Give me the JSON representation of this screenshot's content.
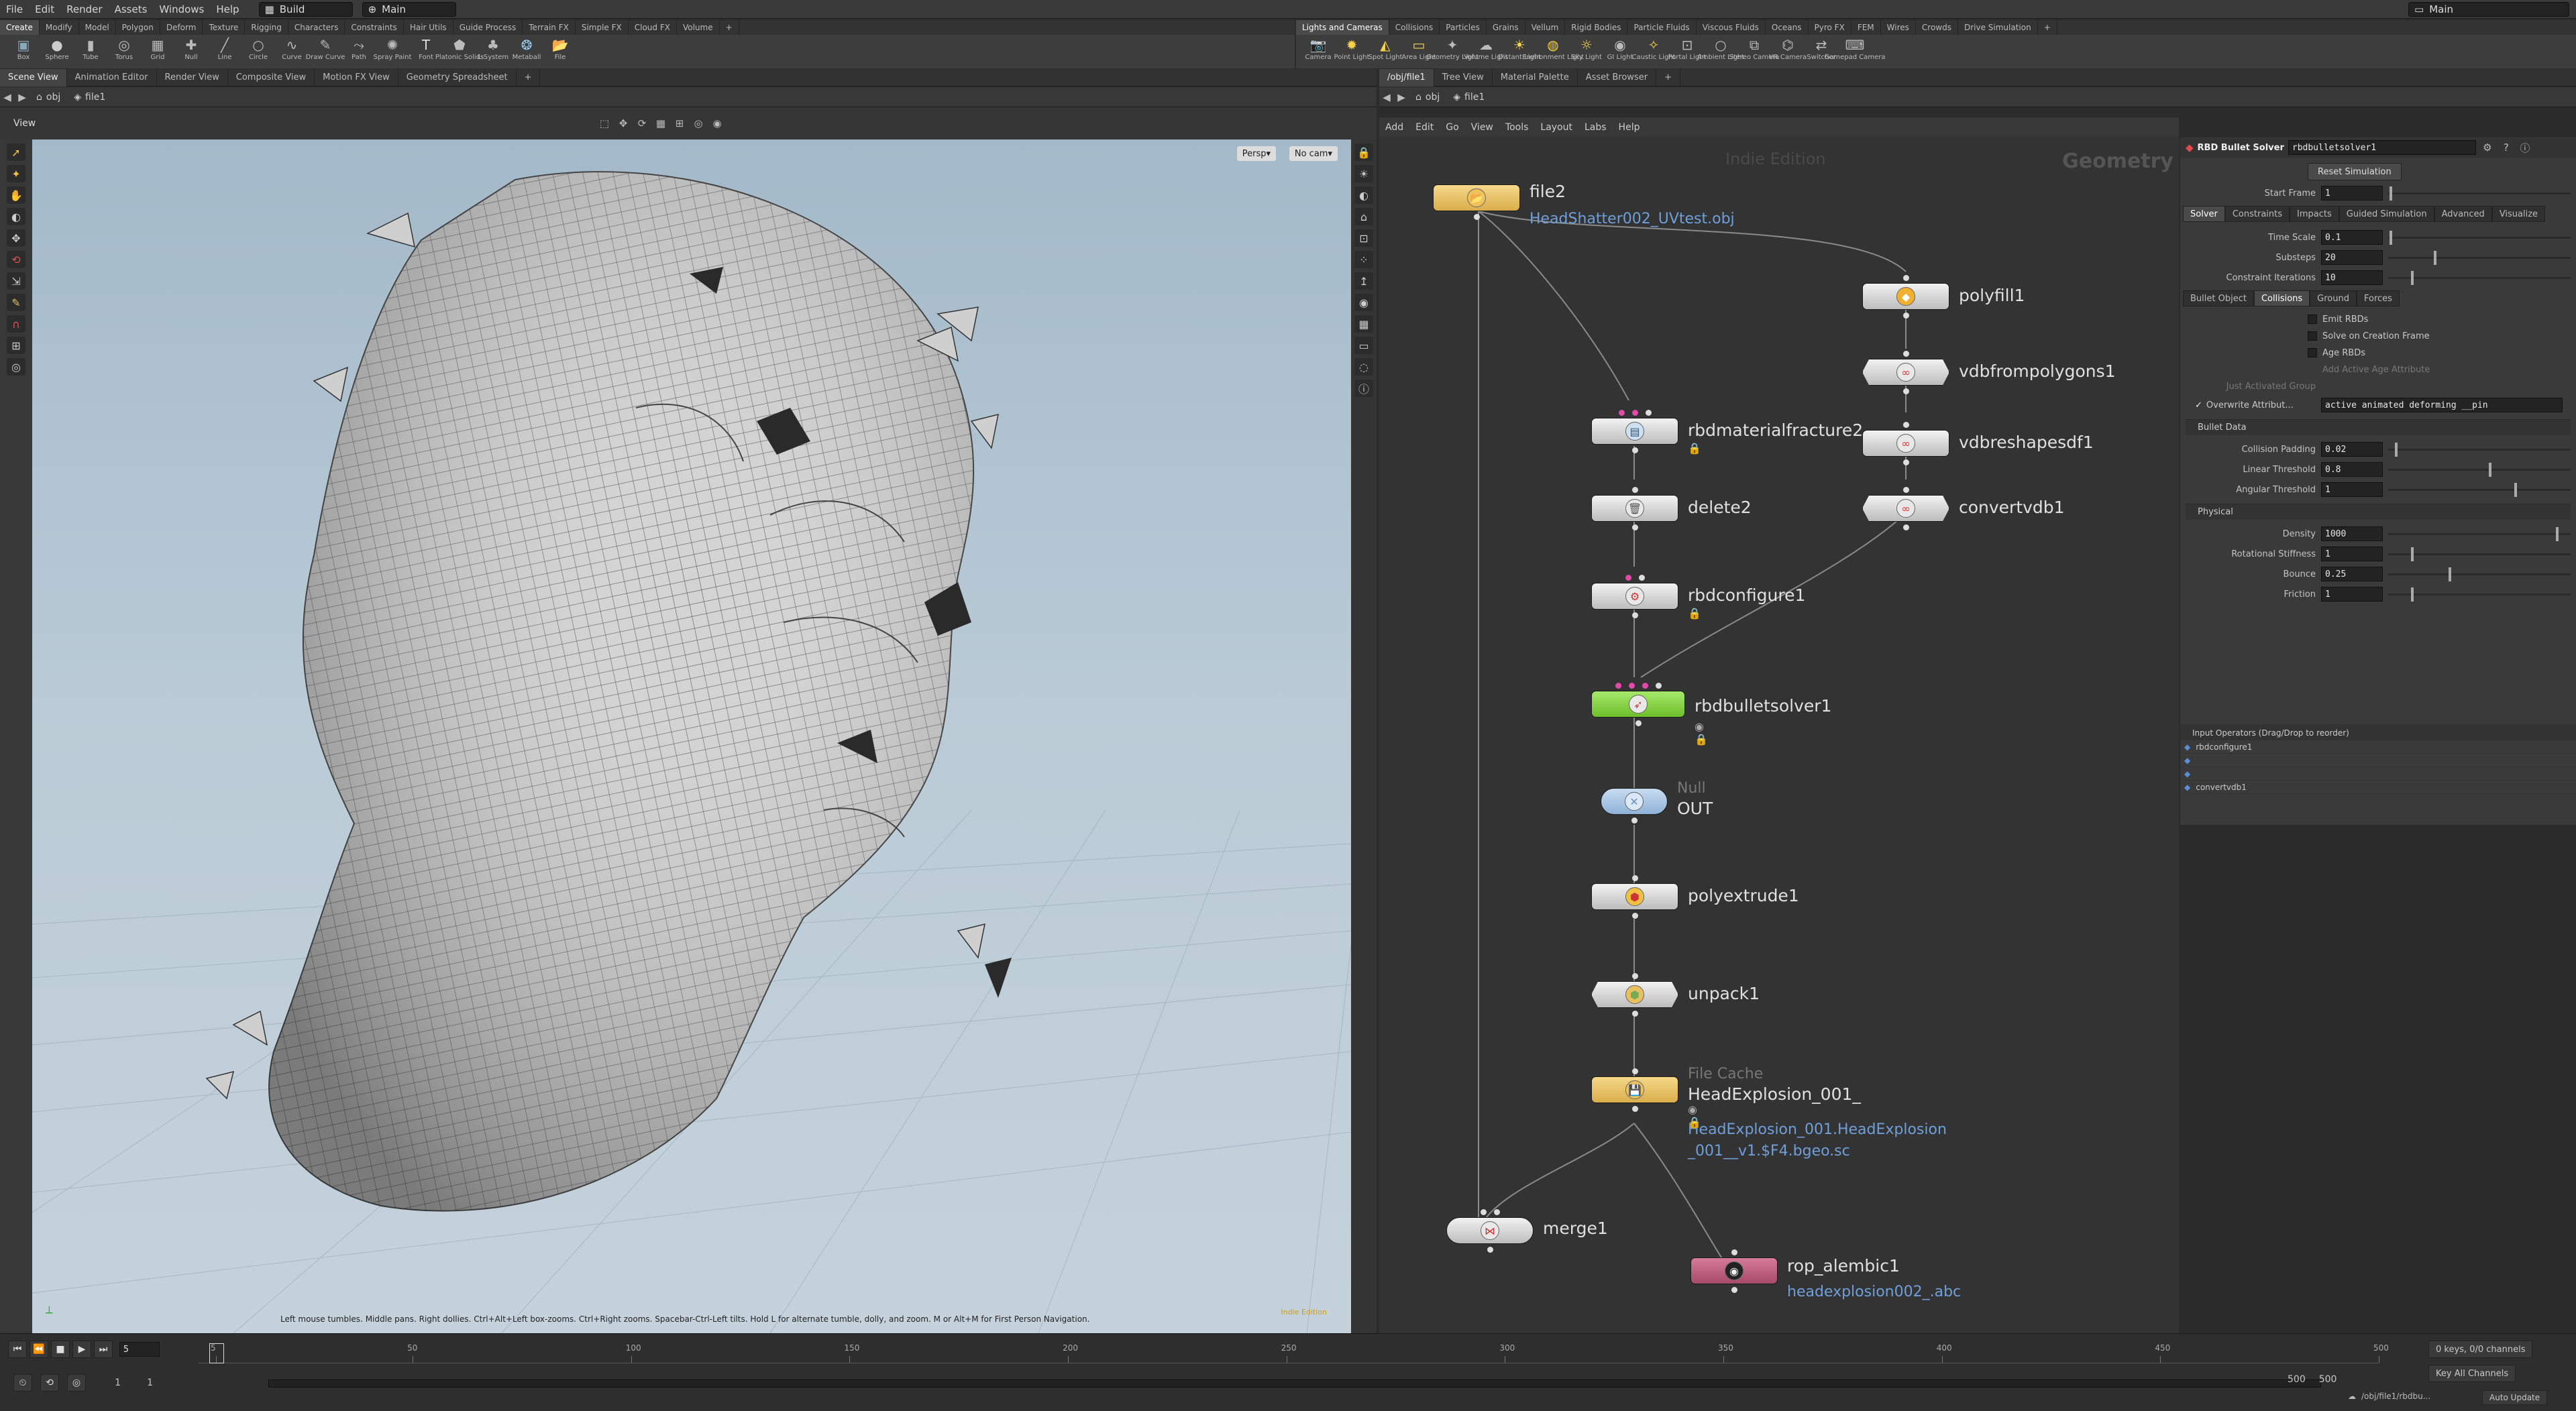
{
  "menubar": {
    "items": [
      "File",
      "Edit",
      "Render",
      "Assets",
      "Windows",
      "Help"
    ],
    "desktop": "Build",
    "context": "Main",
    "context_right": "Main"
  },
  "shelf_left": {
    "tabs": [
      "Create",
      "Modify",
      "Model",
      "Polygon",
      "Deform",
      "Texture",
      "Rigging",
      "Characters",
      "Constraints",
      "Hair Utils",
      "Guide Process",
      "Terrain FX",
      "Simple FX",
      "Cloud FX",
      "Volume"
    ],
    "tools": [
      {
        "label": "Box",
        "icon": "box-icon"
      },
      {
        "label": "Sphere",
        "icon": "sphere-icon"
      },
      {
        "label": "Tube",
        "icon": "tube-icon"
      },
      {
        "label": "Torus",
        "icon": "torus-icon"
      },
      {
        "label": "Grid",
        "icon": "grid-icon"
      },
      {
        "label": "Null",
        "icon": "null-icon"
      },
      {
        "label": "Line",
        "icon": "line-icon"
      },
      {
        "label": "Circle",
        "icon": "circle-icon"
      },
      {
        "label": "Curve",
        "icon": "curve-icon"
      },
      {
        "label": "Draw Curve",
        "icon": "draw-curve-icon"
      },
      {
        "label": "Path",
        "icon": "path-icon"
      },
      {
        "label": "Spray Paint",
        "icon": "spray-paint-icon"
      },
      {
        "label": "Font",
        "icon": "font-icon"
      },
      {
        "label": "Platonic Solids",
        "icon": "platonic-icon"
      },
      {
        "label": "L-System",
        "icon": "lsystem-icon"
      },
      {
        "label": "Metaball",
        "icon": "metaball-icon"
      },
      {
        "label": "File",
        "icon": "file-icon"
      }
    ]
  },
  "shelf_right": {
    "tabs": [
      "Lights and Cameras",
      "Collisions",
      "Particles",
      "Grains",
      "Vellum",
      "Rigid Bodies",
      "Particle Fluids",
      "Viscous Fluids",
      "Oceans",
      "Pyro FX",
      "FEM",
      "Wires",
      "Crowds",
      "Drive Simulation"
    ],
    "tools": [
      {
        "label": "Camera",
        "icon": "camera-icon"
      },
      {
        "label": "Point Light",
        "icon": "point-light-icon"
      },
      {
        "label": "Spot Light",
        "icon": "spot-light-icon"
      },
      {
        "label": "Area Light",
        "icon": "area-light-icon"
      },
      {
        "label": "Geometry Light",
        "icon": "geometry-light-icon"
      },
      {
        "label": "Volume Light",
        "icon": "volume-light-icon"
      },
      {
        "label": "Distant Light",
        "icon": "distant-light-icon"
      },
      {
        "label": "Environment Light",
        "icon": "environment-light-icon"
      },
      {
        "label": "Sky Light",
        "icon": "sky-light-icon"
      },
      {
        "label": "GI Light",
        "icon": "gi-light-icon"
      },
      {
        "label": "Caustic Light",
        "icon": "caustic-light-icon"
      },
      {
        "label": "Portal Light",
        "icon": "portal-light-icon"
      },
      {
        "label": "Ambient Light",
        "icon": "ambient-light-icon"
      },
      {
        "label": "Stereo Camera",
        "icon": "stereo-camera-icon"
      },
      {
        "label": "VR Camera",
        "icon": "vr-camera-icon"
      },
      {
        "label": "Switcher",
        "icon": "switcher-icon"
      },
      {
        "label": "Gamepad Camera",
        "icon": "gamepad-camera-icon"
      }
    ]
  },
  "left_pane": {
    "tabs": [
      "Scene View",
      "Animation Editor",
      "Render View",
      "Composite View",
      "Motion FX View",
      "Geometry Spreadsheet"
    ],
    "path": [
      "obj",
      "file1"
    ],
    "view_label": "View",
    "persp": "Persp",
    "cam": "No cam",
    "hint": "Left mouse tumbles. Middle pans. Right dollies. Ctrl+Alt+Left box-zooms. Ctrl+Right zooms. Spacebar-Ctrl-Left tilts. Hold L for alternate tumble, dolly, and zoom.    M or Alt+M for First Person Navigation.",
    "indie": "Indie Edition"
  },
  "network": {
    "tabs": [
      "/obj/file1",
      "Tree View",
      "Material Palette",
      "Asset Browser"
    ],
    "path": [
      "obj",
      "file1"
    ],
    "menu": [
      "Add",
      "Edit",
      "Go",
      "View",
      "Tools",
      "Layout",
      "Labs",
      "Help"
    ],
    "watermark": "Indie Edition",
    "context_label": "Geometry",
    "nodes": {
      "file2": {
        "name": "file2",
        "sub": "HeadShatter002_UVtest.obj"
      },
      "polyfill1": {
        "name": "polyfill1"
      },
      "vdbfrompolygons1": {
        "name": "vdbfrompolygons1"
      },
      "vdbreshapesdf1": {
        "name": "vdbreshapesdf1"
      },
      "convertvdb1": {
        "name": "convertvdb1"
      },
      "rbdmaterialfracture2": {
        "name": "rbdmaterialfracture2"
      },
      "delete2": {
        "name": "delete2"
      },
      "rbdconfigure1": {
        "name": "rbdconfigure1"
      },
      "rbdbulletsolver1": {
        "name": "rbdbulletsolver1"
      },
      "out": {
        "type": "Null",
        "name": "OUT"
      },
      "polyextrude1": {
        "name": "polyextrude1"
      },
      "unpack1": {
        "name": "unpack1"
      },
      "filecache": {
        "type": "File Cache",
        "name": "HeadExplosion_001_",
        "sub1": "HeadExplosion_001.HeadExplosion",
        "sub2": "_001__v1.$F4.bgeo.sc"
      },
      "merge1": {
        "name": "merge1"
      },
      "rop_alembic1": {
        "name": "rop_alembic1",
        "sub": "headexplosion002_.abc"
      }
    }
  },
  "params": {
    "node_type": "RBD Bullet Solver",
    "node_name": "rbdbulletsolver1",
    "reset_button": "Reset Simulation",
    "start_frame_label": "Start Frame",
    "start_frame": "1",
    "tabs": [
      "Solver",
      "Constraints",
      "Impacts",
      "Guided Simulation",
      "Advanced",
      "Visualize"
    ],
    "time_scale_label": "Time Scale",
    "time_scale": "0.1",
    "substeps_label": "Substeps",
    "substeps": "20",
    "constraint_label": "Constraint Iterations",
    "constraint": "10",
    "subtabs": [
      "Bullet Object",
      "Collisions",
      "Ground",
      "Forces"
    ],
    "emit_rbds": "Emit RBDs",
    "solve_creation": "Solve on Creation Frame",
    "age_rbds": "Age RBDs",
    "add_age": "Add Active Age Attribute",
    "just_activated": "Just Activated Group",
    "overwrite_label": "Overwrite Attribut...",
    "overwrite_value": "active animated deforming __pin",
    "bullet_data": "Bullet Data",
    "collision_padding_label": "Collision Padding",
    "collision_padding": "0.02",
    "linear_label": "Linear Threshold",
    "linear": "0.8",
    "angular_label": "Angular Threshold",
    "angular": "1",
    "physical": "Physical",
    "density_label": "Density",
    "density": "1000",
    "rot_stiff_label": "Rotational Stiffness",
    "rot_stiff": "1",
    "bounce_label": "Bounce",
    "bounce": "0.25",
    "friction_label": "Friction",
    "friction": "1"
  },
  "input_ops": {
    "title": "Input Operators (Drag/Drop to reorder)",
    "items": [
      "rbdconfigure1",
      "",
      "",
      "convertvdb1"
    ]
  },
  "timeline": {
    "frame": "5",
    "start": "1",
    "start2": "1",
    "end": "500",
    "end2": "500",
    "ticks": [
      "5",
      "50",
      "100",
      "150",
      "200",
      "250",
      "300",
      "350",
      "400",
      "450",
      "500"
    ],
    "keys": "0 keys, 0/0 channels",
    "key_all": "Key All Channels",
    "path": "/obj/file1/rbdbu...",
    "auto_update": "Auto Update"
  }
}
